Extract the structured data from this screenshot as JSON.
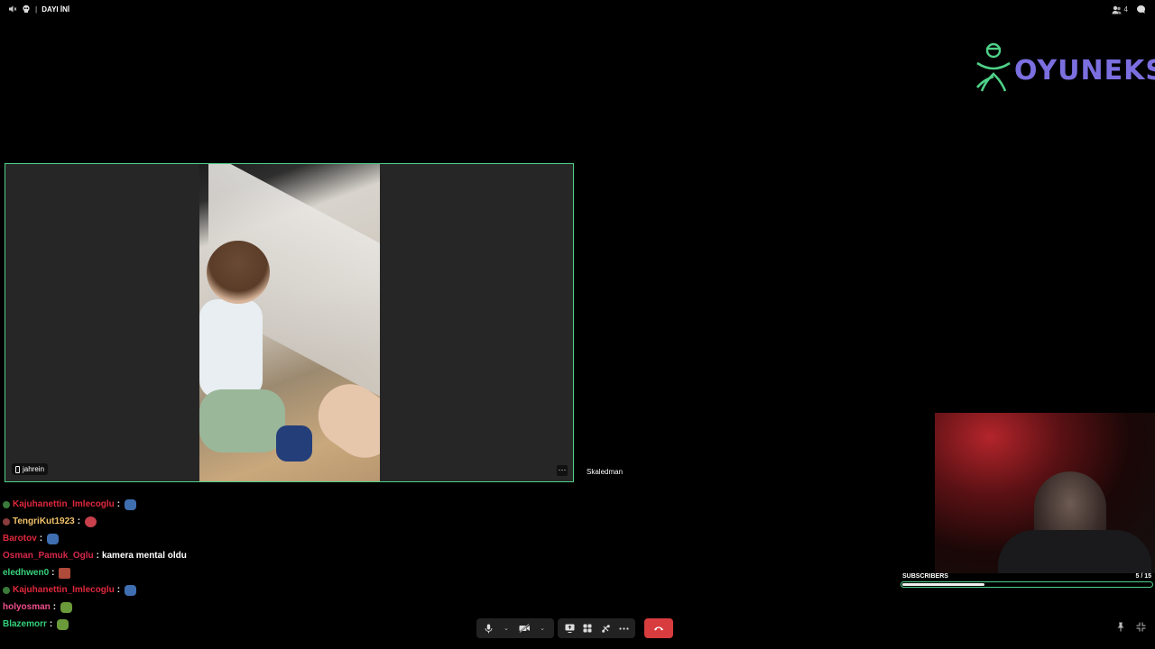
{
  "topbar": {
    "channel_name": "DAYI İNİ",
    "member_count": "4"
  },
  "logo": {
    "text": "OYUNEKS",
    "color": "#7b6fe0",
    "icon_color": "#4fd188"
  },
  "video": {
    "participant_name": "jahrein",
    "more_label": "···",
    "side_participant": "Skaledman"
  },
  "chat": [
    {
      "user": "Kajuhanettin_Imlecoglu",
      "color": "#e0283c",
      "badge": "#3a7a3a",
      "message": "",
      "emote": "#3f6fb0"
    },
    {
      "user": "TengriKut1923",
      "color": "#f2c26b",
      "badge": "#8a3c3c",
      "message": "",
      "emote": "#c8404c"
    },
    {
      "user": "Barotov",
      "color": "#e0283c",
      "badge": "",
      "message": "",
      "emote": "#3f6fb0"
    },
    {
      "user": "Osman_Pamuk_Oglu",
      "color": "#d8284a",
      "badge": "",
      "message": "kamera mental oldu",
      "emote": ""
    },
    {
      "user": "eledhwen0",
      "color": "#36d07a",
      "badge": "",
      "message": "",
      "emote": "#b04a3a"
    },
    {
      "user": "Kajuhanettin_Imlecoglu",
      "color": "#e0283c",
      "badge": "#3a7a3a",
      "message": "",
      "emote": "#3f6fb0"
    },
    {
      "user": "holyosman",
      "color": "#f04f8a",
      "badge": "",
      "message": "",
      "emote": "#6a9a3a"
    },
    {
      "user": "Blazemorr",
      "color": "#36d07a",
      "badge": "",
      "message": "",
      "emote": "#6a9a3a"
    }
  ],
  "subscribers": {
    "label": "SUBSCRIBERS",
    "current": 5,
    "goal": 15,
    "count_text": "5 / 15"
  },
  "controls": {
    "mute_icon": "microphone-icon",
    "camera_icon": "camera-off-icon",
    "share_icon": "screen-share-icon",
    "activities_icon": "apps-icon",
    "soundboard_icon": "soundboard-icon",
    "more_icon": "more-icon",
    "hangup_icon": "hangup-icon"
  },
  "colors": {
    "accent_green": "#4fd188",
    "hangup_red": "#d83c3e"
  }
}
